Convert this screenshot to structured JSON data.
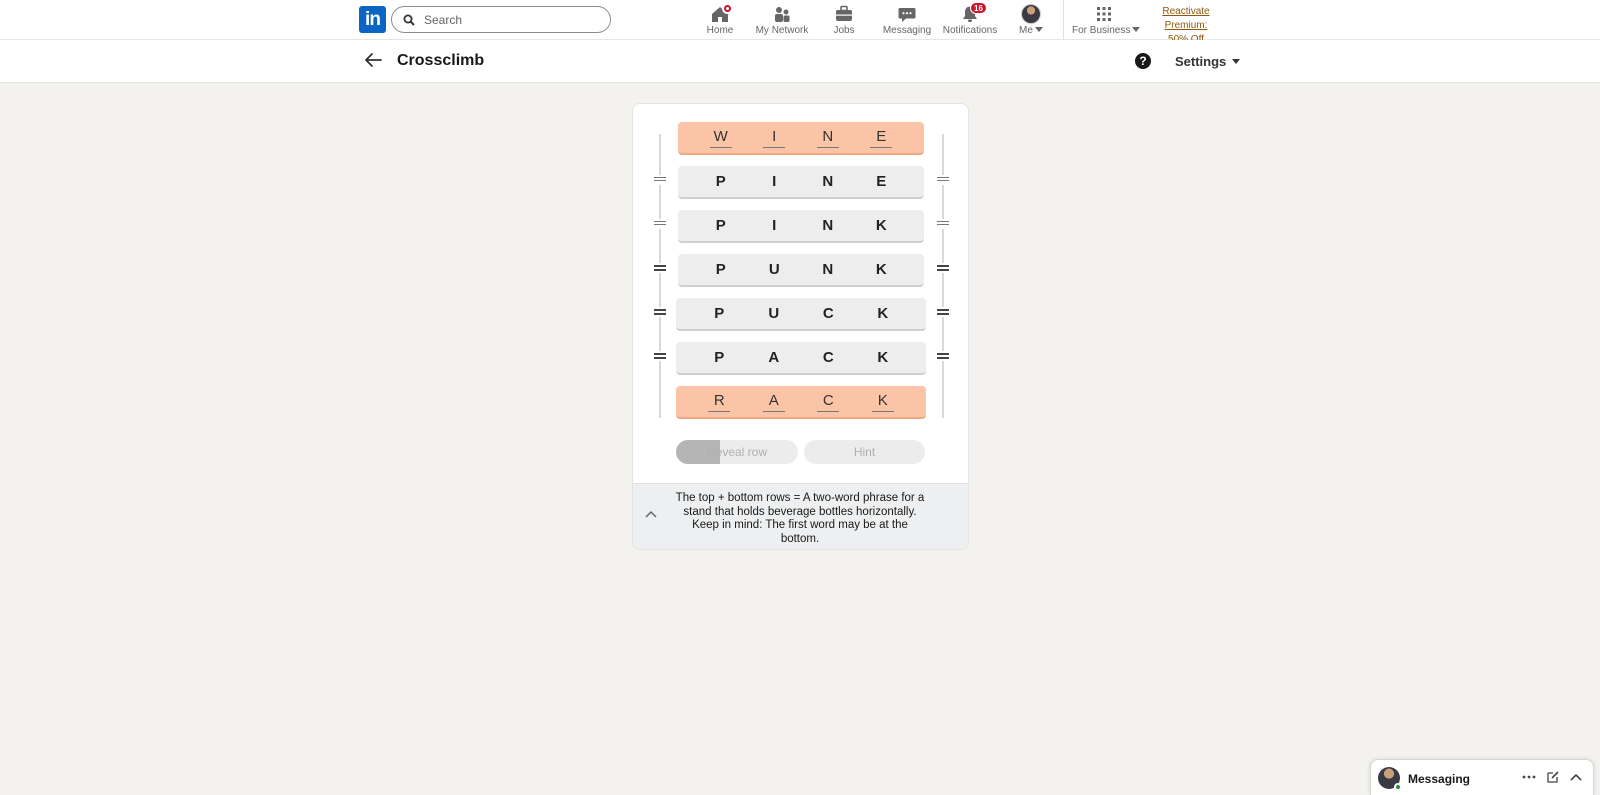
{
  "nav": {
    "logo": "in",
    "search_placeholder": "Search",
    "items": [
      {
        "label": "Home",
        "icon": "home-icon"
      },
      {
        "label": "My Network",
        "icon": "people-icon"
      },
      {
        "label": "Jobs",
        "icon": "briefcase-icon"
      },
      {
        "label": "Messaging",
        "icon": "chat-icon"
      },
      {
        "label": "Notifications",
        "icon": "bell-icon",
        "badge": "16"
      },
      {
        "label": "Me",
        "icon": "avatar"
      },
      {
        "label": "For Business",
        "icon": "grid-icon"
      }
    ],
    "premium_line1": "Reactivate Premium:",
    "premium_line2": "50% Off"
  },
  "subheader": {
    "title": "Crossclimb",
    "settings_label": "Settings"
  },
  "game": {
    "rows": [
      {
        "letters": [
          "W",
          "I",
          "N",
          "E"
        ],
        "locked": true
      },
      {
        "letters": [
          "P",
          "I",
          "N",
          "E"
        ],
        "locked": false
      },
      {
        "letters": [
          "P",
          "I",
          "N",
          "K"
        ],
        "locked": false
      },
      {
        "letters": [
          "P",
          "U",
          "N",
          "K"
        ],
        "locked": false
      },
      {
        "letters": [
          "P",
          "U",
          "C",
          "K"
        ],
        "locked": false
      },
      {
        "letters": [
          "P",
          "A",
          "C",
          "K"
        ],
        "locked": false
      },
      {
        "letters": [
          "R",
          "A",
          "C",
          "K"
        ],
        "locked": true
      }
    ],
    "reveal_label": "Reveal row",
    "reveal_progress": 0.36,
    "hint_label": "Hint",
    "clue": "The top + bottom rows = A two-word phrase for a stand that holds beverage bottles horizontally. Keep in mind: The first word may be at the bottom."
  },
  "messaging": {
    "label": "Messaging"
  },
  "colors": {
    "brand": "#0a66c2",
    "locked_row": "#fbc4a6",
    "row": "#ededed",
    "badge": "#cb112d",
    "premium_link": "#915907"
  }
}
